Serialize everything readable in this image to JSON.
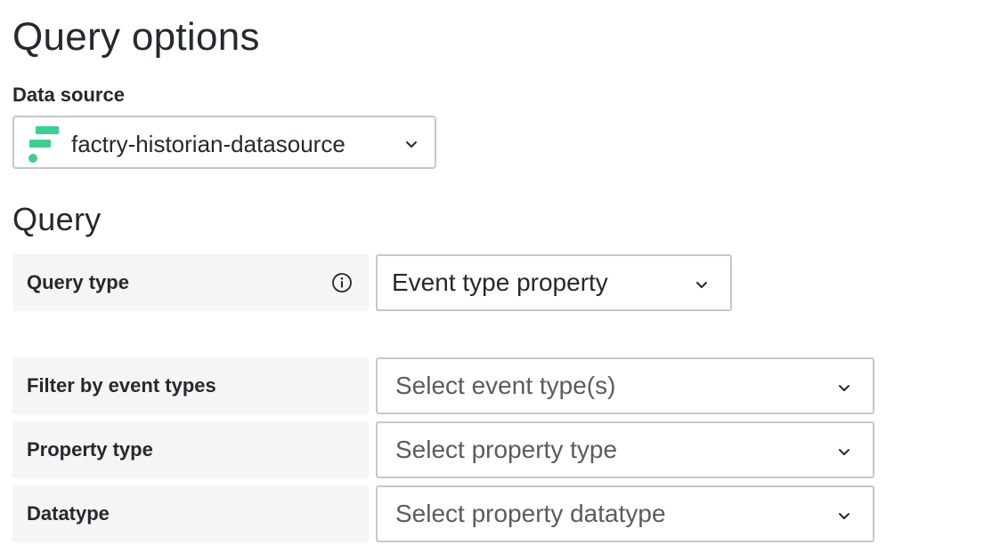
{
  "header": {
    "title": "Query options"
  },
  "data_source": {
    "label": "Data source",
    "value": "factry-historian-datasource",
    "logo_icon": "factry-logo-icon",
    "brand_color": "#3ccf91"
  },
  "query": {
    "title": "Query",
    "rows": [
      {
        "label": "Query type",
        "has_info": true,
        "value": "Event type property",
        "placeholder": ""
      },
      {
        "label": "Filter by event types",
        "has_info": false,
        "value": "",
        "placeholder": "Select event type(s)"
      },
      {
        "label": "Property type",
        "has_info": false,
        "value": "",
        "placeholder": "Select property type"
      },
      {
        "label": "Datatype",
        "has_info": false,
        "value": "",
        "placeholder": "Select property datatype"
      }
    ]
  },
  "icons": {
    "info": "info-circle-icon",
    "chevron": "chevron-down-icon"
  }
}
